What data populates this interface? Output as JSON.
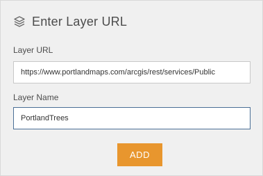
{
  "header": {
    "title": "Enter Layer URL",
    "icon": "layers-icon"
  },
  "form": {
    "url_label": "Layer URL",
    "url_value": "https://www.portlandmaps.com/arcgis/rest/services/Public",
    "name_label": "Layer Name",
    "name_value": "PortlandTrees"
  },
  "actions": {
    "add_label": "ADD"
  },
  "colors": {
    "accent": "#e8962e",
    "panel_bg": "#f0f0f0",
    "focus_border": "#4a6f96"
  }
}
